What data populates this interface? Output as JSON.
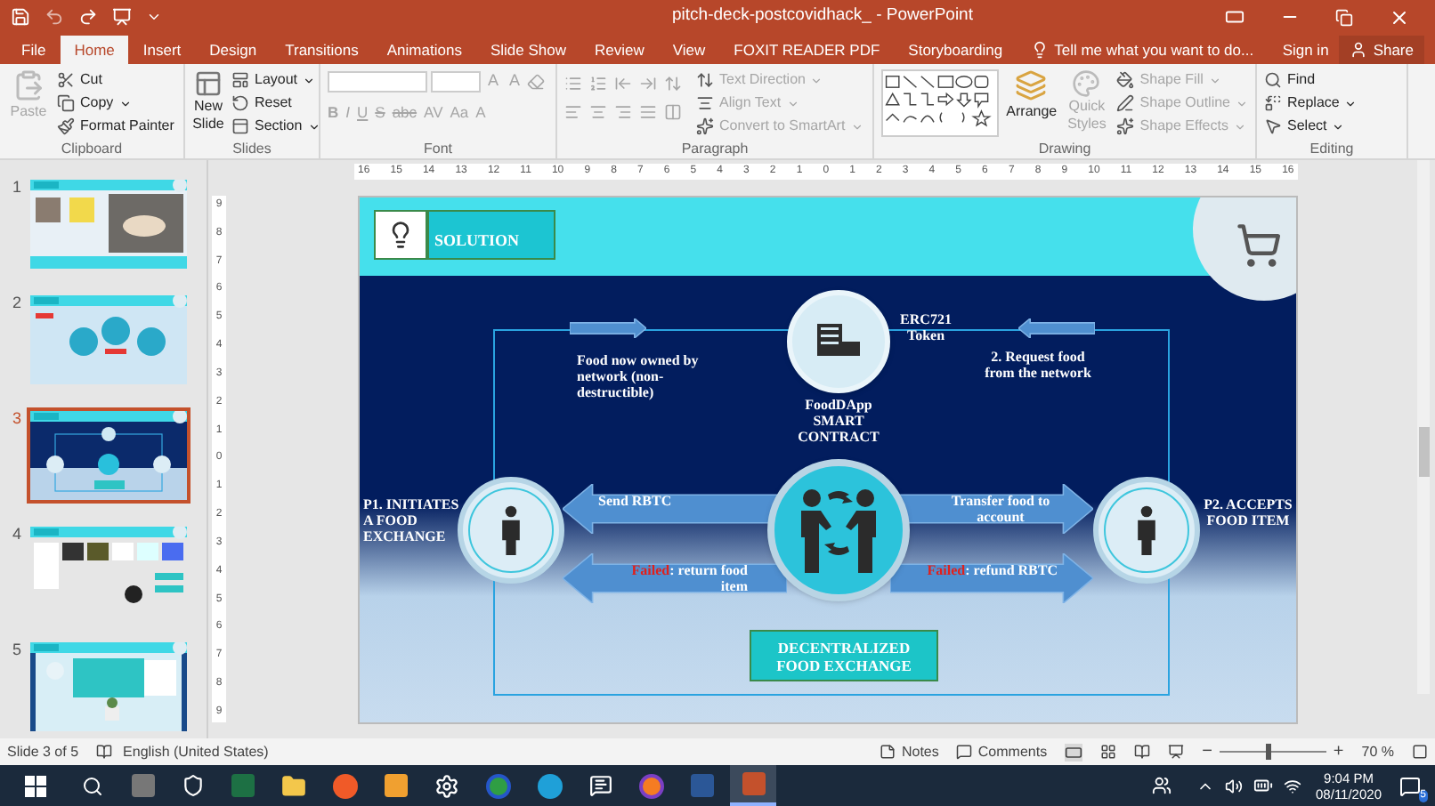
{
  "window": {
    "title": "pitch-deck-postcovidhack_ - PowerPoint"
  },
  "tabs": [
    {
      "label": "File",
      "selected": false
    },
    {
      "label": "Home",
      "selected": true
    },
    {
      "label": "Insert",
      "selected": false
    },
    {
      "label": "Design",
      "selected": false
    },
    {
      "label": "Transitions",
      "selected": false
    },
    {
      "label": "Animations",
      "selected": false
    },
    {
      "label": "Slide Show",
      "selected": false
    },
    {
      "label": "Review",
      "selected": false
    },
    {
      "label": "View",
      "selected": false
    },
    {
      "label": "FOXIT READER PDF",
      "selected": false
    },
    {
      "label": "Storyboarding",
      "selected": false
    }
  ],
  "tell_me": {
    "placeholder": "Tell me what you want to do..."
  },
  "account": {
    "sign_in": "Sign in",
    "share": "Share"
  },
  "ribbon": [
    {
      "kind": "clipboard",
      "label": "Clipboard",
      "items": [
        {
          "label": "Paste",
          "disabled": true
        },
        {
          "label": "Cut",
          "disabled": false
        },
        {
          "label": "Copy",
          "disabled": false
        },
        {
          "label": "Format Painter",
          "disabled": false
        }
      ]
    },
    {
      "kind": "slides",
      "label": "Slides",
      "items": [
        {
          "label": "New Slide",
          "disabled": false
        },
        {
          "label": "Layout",
          "disabled": false
        },
        {
          "label": "Reset",
          "disabled": false
        },
        {
          "label": "Section",
          "disabled": false
        }
      ]
    },
    {
      "kind": "font",
      "label": "Font",
      "glyphs": [
        {
          "label": "B",
          "disabled": true
        },
        {
          "label": "I",
          "disabled": true
        },
        {
          "label": "U",
          "disabled": true
        },
        {
          "label": "S",
          "disabled": true
        },
        {
          "label": "abc",
          "disabled": true
        },
        {
          "label": "AV",
          "disabled": true
        },
        {
          "label": "Aa",
          "disabled": true
        },
        {
          "label": "A",
          "disabled": true
        }
      ],
      "size_glyphs": [
        {
          "label": "A",
          "disabled": true
        },
        {
          "label": "A",
          "disabled": true
        }
      ]
    },
    {
      "kind": "paragraph",
      "label": "Paragraph",
      "items": [
        {
          "label": "Text Direction",
          "disabled": true
        },
        {
          "label": "Align Text",
          "disabled": true
        },
        {
          "label": "Convert to SmartArt",
          "disabled": true
        }
      ]
    },
    {
      "kind": "drawing",
      "label": "Drawing",
      "items": [
        {
          "label": "Arrange",
          "disabled": false
        },
        {
          "label": "Quick Styles",
          "disabled": true
        },
        {
          "label": "Shape Fill",
          "disabled": true
        },
        {
          "label": "Shape Outline",
          "disabled": true
        },
        {
          "label": "Shape Effects",
          "disabled": true
        }
      ]
    },
    {
      "kind": "editing",
      "label": "Editing",
      "items": [
        {
          "label": "Find",
          "disabled": false
        },
        {
          "label": "Replace",
          "disabled": false
        },
        {
          "label": "Select",
          "disabled": false
        }
      ]
    }
  ],
  "thumbnails": [
    {
      "number": "1",
      "kind": "photos",
      "selected": false
    },
    {
      "number": "2",
      "kind": "circles",
      "selected": false
    },
    {
      "number": "3",
      "kind": "diagram",
      "selected": true
    },
    {
      "number": "4",
      "kind": "gallery",
      "selected": false
    },
    {
      "number": "5",
      "kind": "plant",
      "selected": false
    }
  ],
  "rulers": {
    "horizontal": [
      "16",
      "15",
      "14",
      "13",
      "12",
      "11",
      "10",
      "9",
      "8",
      "7",
      "6",
      "5",
      "4",
      "3",
      "2",
      "1",
      "0",
      "1",
      "2",
      "3",
      "4",
      "5",
      "6",
      "7",
      "8",
      "9",
      "10",
      "11",
      "12",
      "13",
      "14",
      "15",
      "16"
    ],
    "vertical": [
      "9",
      "8",
      "7",
      "6",
      "5",
      "4",
      "3",
      "2",
      "1",
      "0",
      "1",
      "2",
      "3",
      "4",
      "5",
      "6",
      "7",
      "8",
      "9"
    ]
  },
  "slide": {
    "title": "SOLUTION",
    "token": "ERC721 Token",
    "contract": "FoodDApp SMART CONTRACT",
    "top_left_note": "Food now owned by network (non-destructible)",
    "top_right_note": "2. Request food from the network",
    "parties": [
      {
        "label": "P1. INITIATES A FOOD EXCHANGE"
      },
      {
        "label": "P2. ACCEPTS FOOD ITEM"
      }
    ],
    "flows": [
      {
        "text": "Send RBTC"
      },
      {
        "text": "Transfer  food to account"
      },
      {
        "highlight": "Failed",
        "text": ": return food item"
      },
      {
        "highlight": "Failed",
        "text": ": refund RBTC"
      }
    ],
    "footer": "DECENTRALIZED FOOD EXCHANGE"
  },
  "status_bar": {
    "slide_info": "Slide 3 of 5",
    "language": "English (United States)",
    "notes": "Notes",
    "comments": "Comments",
    "zoom_out": "−",
    "zoom_in": "+",
    "zoom": {
      "level": 0.45
    },
    "zoom_percent": "70 %"
  },
  "taskbar": {
    "time": "9:04 PM",
    "date": "08/11/2020",
    "notification_count": "5"
  }
}
